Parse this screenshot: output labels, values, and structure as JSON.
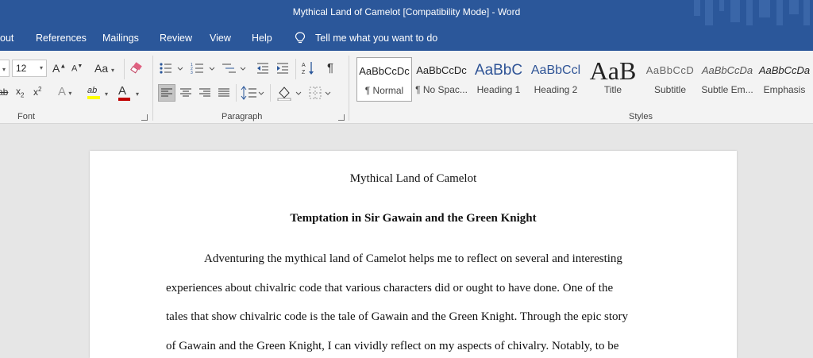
{
  "window": {
    "title": "Mythical Land of Camelot [Compatibility Mode]  -  Word"
  },
  "menu": {
    "items": [
      "out",
      "References",
      "Mailings",
      "Review",
      "View",
      "Help"
    ],
    "tell_me": "Tell me what you want to do"
  },
  "font_group": {
    "label": "Font",
    "font_size": "12",
    "grow_icon": "A",
    "shrink_icon": "A",
    "change_case": "Aa",
    "subscript": "x",
    "subscript_mark": "2",
    "superscript": "x",
    "superscript_mark": "2",
    "text_effects": "A",
    "highlight": "ab",
    "font_color": "A",
    "highlight_color": "#ffff00",
    "font_color_value": "#c00000"
  },
  "paragraph_group": {
    "label": "Paragraph",
    "pilcrow": "¶"
  },
  "styles_group": {
    "label": "Styles",
    "items": [
      {
        "preview": "AaBbCcDc",
        "label": "¶ Normal"
      },
      {
        "preview": "AaBbCcDc",
        "label": "¶ No Spac..."
      },
      {
        "preview": "AaBbC",
        "label": "Heading 1"
      },
      {
        "preview": "AaBbCcl",
        "label": "Heading 2"
      },
      {
        "preview": "AaB",
        "label": "Title"
      },
      {
        "preview": "AaBbCcD",
        "label": "Subtitle"
      },
      {
        "preview": "AaBbCcDa",
        "label": "Subtle Em..."
      },
      {
        "preview": "AaBbCcDa",
        "label": "Emphasis"
      }
    ]
  },
  "document": {
    "title": "Mythical Land of Camelot",
    "heading": "Temptation in Sir Gawain and the Green Knight",
    "lines": [
      "Adventuring the mythical land of Camelot helps me to reflect on several and interesting",
      "experiences about chivalric code that various characters did or ought to have done. One of the",
      "tales that show chivalric code is the tale of Gawain and the Green Knight. Through the epic story",
      "of Gawain and the Green Knight, I can vividly reflect on my aspects of chivalry. Notably, to be"
    ]
  },
  "colors": {
    "word_blue": "#2b579a",
    "ribbon_bg": "#f3f3f3",
    "doc_bg": "#e6e6e6"
  }
}
